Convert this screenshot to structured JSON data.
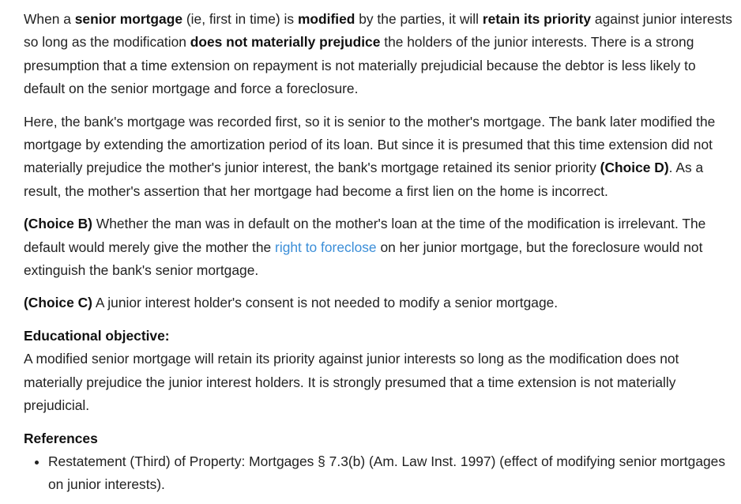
{
  "p1": {
    "t1": "When a ",
    "b1": "senior mortgage",
    "t2": " (ie, first in time) is ",
    "b2": "modified",
    "t3": " by the parties, it will ",
    "b3": "retain its priority",
    "t4": " against junior interests so long as the modification ",
    "b4": "does not materially prejudice",
    "t5": " the holders of the junior interests.  There is a strong presumption that a time extension on repayment is not materially prejudicial because the debtor is less likely to default on the senior mortgage and force a foreclosure."
  },
  "p2": {
    "t1": "Here, the bank's mortgage was recorded first, so it is senior to the mother's mortgage.  The bank later modified the mortgage by extending the amortization period of its loan.  But since it is presumed that this time extension did not materially prejudice the mother's junior interest, the bank's mortgage retained its senior priority ",
    "b1": "(Choice D)",
    "t2": ".  As a result, the mother's assertion that her mortgage had become a first lien on the home is incorrect."
  },
  "p3": {
    "b1": "(Choice B)",
    "t1": "  Whether the man was in default on the mother's loan at the time of the modification is irrelevant.  The default would merely give the mother the ",
    "link": "right to foreclose",
    "t2": " on her junior mortgage, but the foreclosure would not extinguish the bank's senior mortgage."
  },
  "p4": {
    "b1": "(Choice C)",
    "t1": "  A junior interest holder's consent is not needed to modify a senior mortgage."
  },
  "objective": {
    "heading": "Educational objective:",
    "text": "A modified senior mortgage will retain its priority against junior interests so long as the modification does not materially prejudice the junior interest holders.  It is strongly presumed that a time extension is not materially prejudicial."
  },
  "references": {
    "heading": "References",
    "items": [
      "Restatement (Third) of Property: Mortgages § 7.3(b) (Am. Law Inst. 1997) (effect of modifying senior mortgages on junior interests)."
    ]
  },
  "colors": {
    "link": "#3b8ed8",
    "text": "#222222"
  }
}
